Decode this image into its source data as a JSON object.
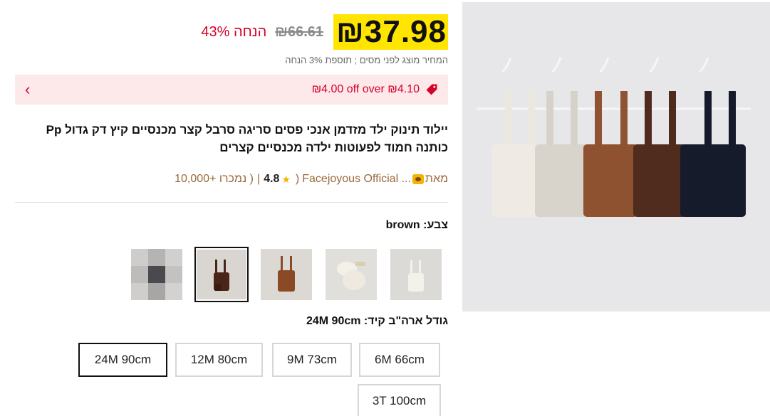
{
  "price": {
    "current": "₪37.98",
    "original": "₪66.61",
    "discount": "43% הנחה",
    "note": "המחיר מוצג לפני מסים ; תוספת 3% הנחה"
  },
  "coupon": {
    "text": "₪4.00 off over ₪4.10",
    "arrow": "‹"
  },
  "product": {
    "title": "יילוד תינוק ילד מזדמן אנכי פסים סריגה סרבל קצר מכנסיים קיץ דק גדול Pp כותנה חמוד לפעוטות ילדה מכנסיים קצרים"
  },
  "store": {
    "sold": "( נמכרו +10,000",
    "sep": "|",
    "rating": "4.8",
    "name": "Facejoyous Official ...",
    "suffix": "מאת"
  },
  "color": {
    "label": "צבע:",
    "value": "brown"
  },
  "size": {
    "label": "גודל ארה\"ב קיד:",
    "value": "24M 90cm",
    "options": [
      "6M 66cm",
      "9M 73cm",
      "12M 80cm",
      "24M 90cm",
      "3T 100cm"
    ]
  },
  "colors": {
    "price_highlight": "#ffe500",
    "discount_red": "#d6002a",
    "coupon_bg": "#fde8ea"
  }
}
